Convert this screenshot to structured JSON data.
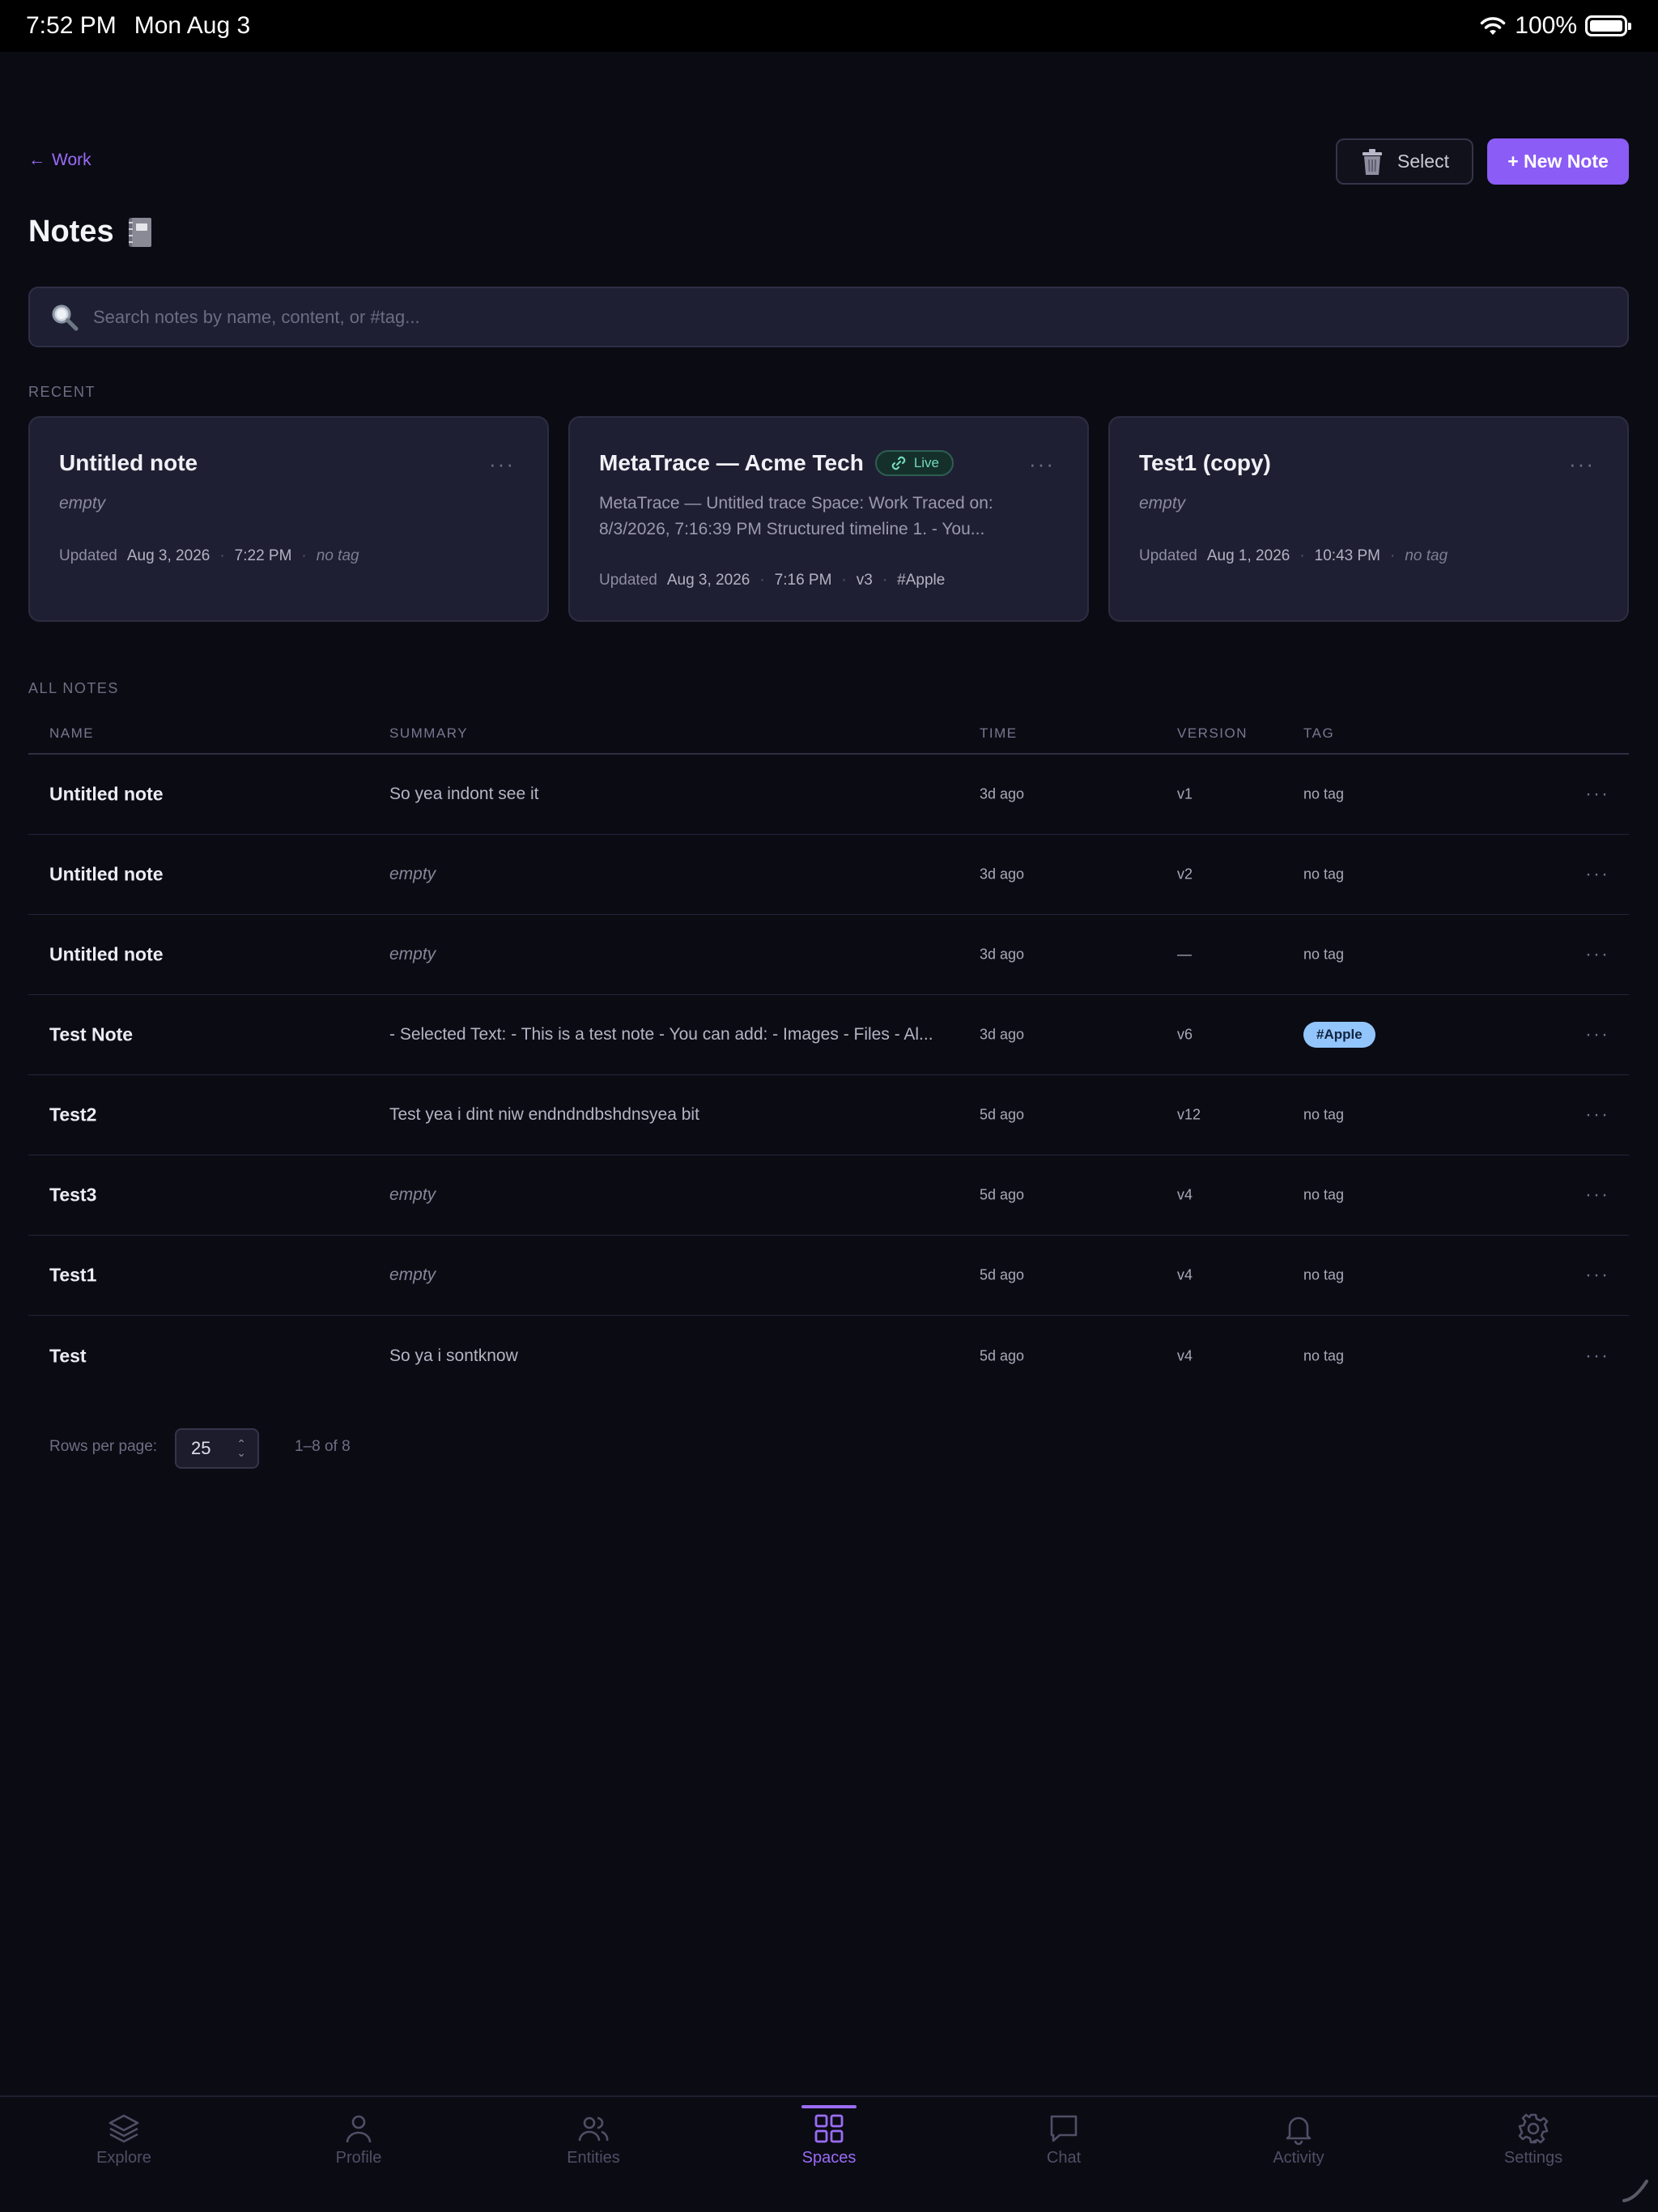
{
  "status_bar": {
    "time": "7:52 PM",
    "date": "Mon Aug 3",
    "battery": "100%"
  },
  "header": {
    "back_label": "Work",
    "select_label": "Select",
    "new_note_label": "+ New Note",
    "title": "Notes"
  },
  "search": {
    "placeholder": "Search notes by name, content, or #tag..."
  },
  "recent": {
    "label": "RECENT",
    "cards": [
      {
        "title": "Untitled note",
        "body": "empty",
        "updated_label": "Updated",
        "date": "Aug 3, 2026",
        "time": "7:22 PM",
        "tag": "no tag"
      },
      {
        "title": "MetaTrace — Acme Tech",
        "badge": "Live",
        "body": "MetaTrace — Untitled trace Space: Work Traced on: 8/3/2026, 7:16:39 PM Structured timeline 1. - You...",
        "updated_label": "Updated",
        "date": "Aug 3, 2026",
        "time": "7:16 PM",
        "version": "v3",
        "tag": "#Apple"
      },
      {
        "title": "Test1 (copy)",
        "body": "empty",
        "updated_label": "Updated",
        "date": "Aug 1, 2026",
        "time": "10:43 PM",
        "tag": "no tag"
      }
    ]
  },
  "all_notes": {
    "label": "ALL NOTES",
    "columns": {
      "name": "NAME",
      "summary": "SUMMARY",
      "time": "TIME",
      "version": "VERSION",
      "tag": "TAG"
    },
    "rows": [
      {
        "name": "Untitled note",
        "summary": "So yea indont see it",
        "time": "3d ago",
        "version": "v1",
        "tag": "no tag"
      },
      {
        "name": "Untitled note",
        "summary": "empty",
        "time": "3d ago",
        "version": "v2",
        "tag": "no tag"
      },
      {
        "name": "Untitled note",
        "summary": "empty",
        "time": "3d ago",
        "version": "—",
        "tag": "no tag"
      },
      {
        "name": "Test Note",
        "summary": "- Selected Text: - This is a test note - You can add: - Images - Files - Al...",
        "time": "3d ago",
        "version": "v6",
        "tag": "#Apple"
      },
      {
        "name": "Test2",
        "summary": "Test yea i dint niw endndndbshdnsyea bit",
        "time": "5d ago",
        "version": "v12",
        "tag": "no tag"
      },
      {
        "name": "Test3",
        "summary": "empty",
        "time": "5d ago",
        "version": "v4",
        "tag": "no tag"
      },
      {
        "name": "Test1",
        "summary": "empty",
        "time": "5d ago",
        "version": "v4",
        "tag": "no tag"
      },
      {
        "name": "Test",
        "summary": "So ya i sontknow",
        "time": "5d ago",
        "version": "v4",
        "tag": "no tag"
      }
    ]
  },
  "pagination": {
    "rows_label": "Rows per page:",
    "rows_value": "25",
    "range": "1–8 of 8"
  },
  "tabbar": {
    "tabs": [
      {
        "label": "Explore",
        "icon": "layers-icon"
      },
      {
        "label": "Profile",
        "icon": "person-icon"
      },
      {
        "label": "Entities",
        "icon": "people-icon"
      },
      {
        "label": "Spaces",
        "icon": "grid-icon",
        "active": true
      },
      {
        "label": "Chat",
        "icon": "chat-bubble-icon"
      },
      {
        "label": "Activity",
        "icon": "bell-icon"
      },
      {
        "label": "Settings",
        "icon": "gear-icon"
      }
    ]
  },
  "colors": {
    "accent": "#8b5cf6",
    "background": "#0b0b14",
    "card": "#1f1f33",
    "tag_pill": "#93c5fd",
    "live": "#73d9b8"
  }
}
